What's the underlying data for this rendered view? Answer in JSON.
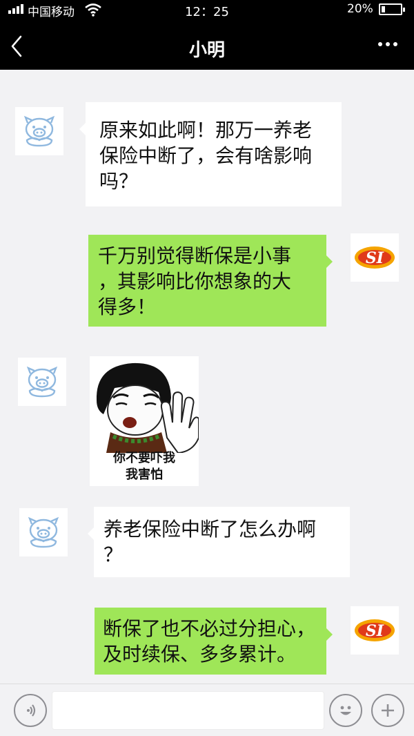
{
  "status_bar": {
    "carrier": "中国移动",
    "time": "12：25",
    "battery": "20%",
    "battery_level": 0.2
  },
  "nav": {
    "title": "小明",
    "back_icon": "chevron-left-icon",
    "more_icon": "more-dots-icon"
  },
  "messages": [
    {
      "side": "left",
      "lines": [
        "原来如此啊！那万一养老",
        "保险中断了，会有啥影响",
        "吗？"
      ]
    },
    {
      "side": "right",
      "lines": [
        "千万别觉得断保是小事",
        "，其影响比你想象的大",
        "得多！"
      ]
    },
    {
      "side": "left",
      "type": "sticker",
      "caption": [
        "你不要吓我",
        "我害怕"
      ]
    },
    {
      "side": "left",
      "lines": [
        "养老保险中断了怎么办啊",
        "？"
      ]
    },
    {
      "side": "right",
      "lines": [
        "断保了也不必过分担心，",
        "及时续保、多多累计。"
      ]
    }
  ],
  "avatars": {
    "contact_icon": "pig-avatar-icon",
    "self_logo_text": "SI"
  },
  "input_bar": {
    "voice_icon": "voice-icon",
    "emoji_icon": "emoji-icon",
    "plus_icon": "plus-icon"
  },
  "colors": {
    "nav_bg": "#000000",
    "chat_bg": "#f2f2f4",
    "sent_bubble": "#9fe658",
    "received_bubble": "#ffffff",
    "avatar_line": "#8fb8df",
    "logo_red": "#e03a1a",
    "logo_orange": "#f5a400"
  }
}
